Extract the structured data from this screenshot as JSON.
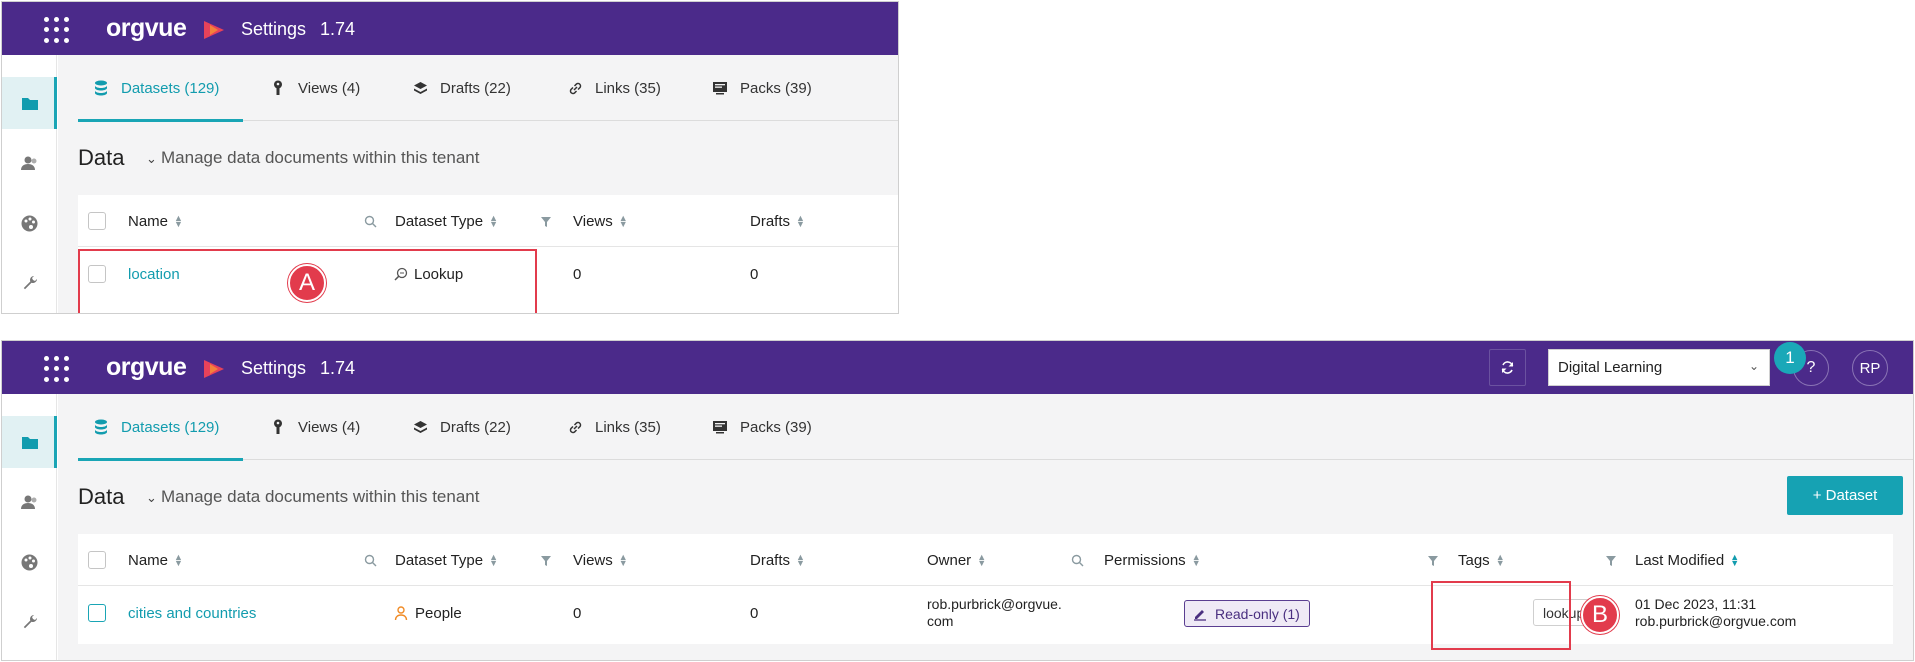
{
  "app": {
    "logo": "orgvue",
    "title": "Settings",
    "version": "1.74"
  },
  "colors": {
    "topbar": "#4b2a8a",
    "accent": "#19a5b5",
    "annotation": "#e23b4c"
  },
  "sidebar_icons": [
    "folder-icon",
    "users-icon",
    "palette-icon",
    "wrench-icon"
  ],
  "tabs": [
    {
      "label": "Datasets (129)",
      "icon": "database-icon"
    },
    {
      "label": "Views (4)",
      "icon": "key-icon"
    },
    {
      "label": "Drafts (22)",
      "icon": "layers-icon"
    },
    {
      "label": "Links (35)",
      "icon": "link-icon"
    },
    {
      "label": "Packs (39)",
      "icon": "pack-icon"
    }
  ],
  "page": {
    "title": "Data",
    "subtitle": "Manage data documents within this tenant"
  },
  "columns": {
    "name": "Name",
    "dataset_type": "Dataset Type",
    "views": "Views",
    "drafts": "Drafts",
    "owner": "Owner",
    "permissions": "Permissions",
    "tags": "Tags",
    "last_modified": "Last Modified"
  },
  "panel_a": {
    "row": {
      "name": "location",
      "type": "Lookup",
      "views": "0",
      "drafts": "0"
    },
    "annotation": "A"
  },
  "panel_b": {
    "header": {
      "tenant": "Digital Learning",
      "help": "?",
      "avatar": "RP",
      "badge": "1"
    },
    "add_button": "+ Dataset",
    "row": {
      "name": "cities and countries",
      "type": "People",
      "views": "0",
      "drafts": "0",
      "owner_line1": "rob.purbrick@orgvue.",
      "owner_line2": "com",
      "permissions": "Read-only (1)",
      "tag": "lookup",
      "modified_line1": "01 Dec 2023, 11:31",
      "modified_line2": "rob.purbrick@orgvue.com"
    },
    "annotation": "B"
  }
}
